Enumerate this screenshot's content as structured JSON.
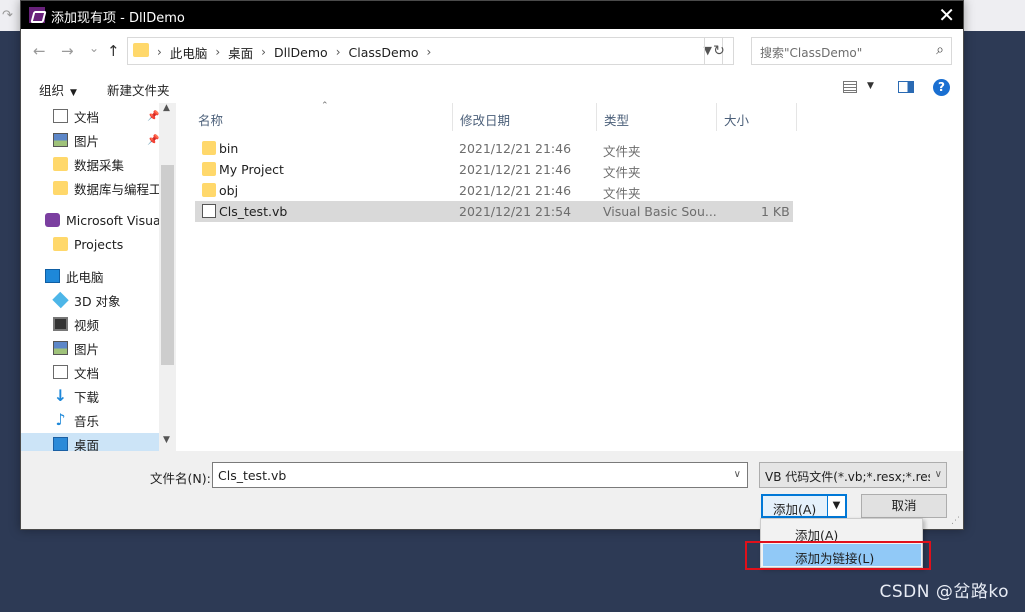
{
  "background": {
    "redo_glyph": "↷",
    "watermark": "CSDN @岔路ko"
  },
  "dialog": {
    "title": "添加现有项 - DllDemo",
    "close_glyph": "✕",
    "nav": {
      "back": "←",
      "forward": "→",
      "recent": "⌄",
      "up": "↑"
    },
    "breadcrumbs": [
      "此电脑",
      "桌面",
      "DllDemo",
      "ClassDemo"
    ],
    "crumb_sep": "›",
    "search_placeholder": "搜索\"ClassDemo\"",
    "toolbar": {
      "organize": "组织",
      "new_folder": "新建文件夹",
      "help": "?"
    },
    "sidebar": [
      {
        "label": "文档",
        "icon": "document-icon",
        "pinned": true
      },
      {
        "label": "图片",
        "icon": "pictures-icon",
        "pinned": true
      },
      {
        "label": "数据采集",
        "icon": "folder-icon"
      },
      {
        "label": "数据库与编程工...",
        "icon": "folder-icon"
      },
      {
        "label": "Microsoft Visual",
        "icon": "visual-studio-icon"
      },
      {
        "label": "Projects",
        "icon": "folder-icon"
      },
      {
        "label": "此电脑",
        "icon": "computer-icon"
      },
      {
        "label": "3D 对象",
        "icon": "3d-objects-icon"
      },
      {
        "label": "视频",
        "icon": "video-icon"
      },
      {
        "label": "图片",
        "icon": "pictures-icon"
      },
      {
        "label": "文档",
        "icon": "document-icon"
      },
      {
        "label": "下载",
        "icon": "download-icon"
      },
      {
        "label": "音乐",
        "icon": "music-icon"
      },
      {
        "label": "桌面",
        "icon": "desktop-icon",
        "selected": true
      }
    ],
    "columns": [
      "名称",
      "修改日期",
      "类型",
      "大小"
    ],
    "files": [
      {
        "name": "bin",
        "date": "2021/12/21 21:46",
        "type": "文件夹",
        "size": "",
        "icon": "folder-icon"
      },
      {
        "name": "My Project",
        "date": "2021/12/21 21:46",
        "type": "文件夹",
        "size": "",
        "icon": "folder-icon"
      },
      {
        "name": "obj",
        "date": "2021/12/21 21:46",
        "type": "文件夹",
        "size": "",
        "icon": "folder-icon"
      },
      {
        "name": "Cls_test.vb",
        "date": "2021/12/21 21:54",
        "type": "Visual Basic Sou...",
        "size": "1 KB",
        "icon": "vb-file-icon",
        "selected": true
      }
    ],
    "filename_label": "文件名(N):",
    "filename_value": "Cls_test.vb",
    "filter_value": "VB 代码文件(*.vb;*.resx;*.resw",
    "add_button": "添加(A)",
    "cancel_button": "取消",
    "dropdown_menu": [
      "添加(A)",
      "添加为链接(L)"
    ],
    "highlighted_menu_item": "添加为链接(L)",
    "colors": {
      "titlebar": "#000000",
      "accent": "#0078d7",
      "highlight": "#91c9f7",
      "annotation": "#e0101a"
    }
  }
}
